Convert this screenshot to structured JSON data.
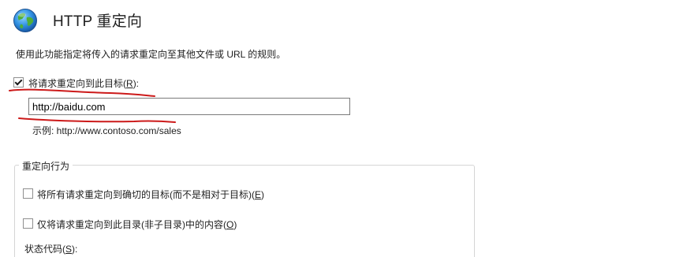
{
  "header": {
    "title": "HTTP 重定向",
    "icon": "globe-icon"
  },
  "description": "使用此功能指定将传入的请求重定向至其他文件或 URL 的规则。",
  "redirect": {
    "checkbox_label": "将请求重定向到此目标",
    "checkbox_hotkey": "R",
    "checked": true,
    "destination_value": "http://baidu.com",
    "example": "示例: http://www.contoso.com/sales"
  },
  "behavior": {
    "group_label": "重定向行为",
    "options": [
      {
        "label": "将所有请求重定向到确切的目标(而不是相对于目标)",
        "hotkey": "E",
        "checked": false
      },
      {
        "label": "仅将请求重定向到此目录(非子目录)中的内容",
        "hotkey": "O",
        "checked": false
      }
    ],
    "status_code_label": "状态代码",
    "status_code_hotkey": "S"
  },
  "annotation_color": "#cc1a1a"
}
